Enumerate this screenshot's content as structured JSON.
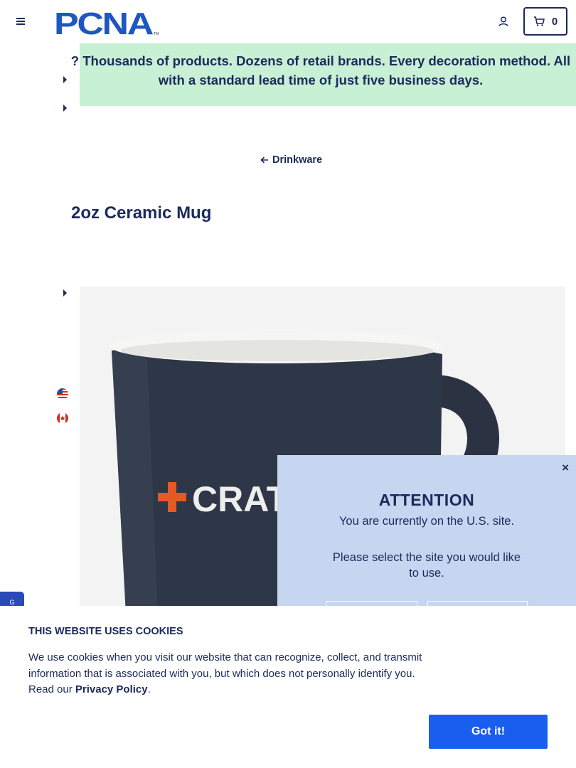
{
  "header": {
    "logo_text": "PCNA",
    "logo_tm": "TM",
    "cart_count": "0",
    "menu_icon": "hamburger-icon",
    "account_icon": "user-icon",
    "cart_icon": "cart-icon"
  },
  "announcement": {
    "text_line1": "Thousands of products. Dozens of retail brands. Every decoration method. All",
    "text_line2": "with a standard lead time of just five business days.",
    "prefix_fragment": "?",
    "background": "#c8f0d4"
  },
  "breadcrumb": {
    "back_label": "Drinkware"
  },
  "product": {
    "title": "2oz Ceramic Mug",
    "image_logo_text": "CRAT"
  },
  "side_tab": {
    "label": "G"
  },
  "country_modal": {
    "title": "ATTENTION",
    "line1": "You are currently on the U.S. site.",
    "line2": "Please select the site you would like to use.",
    "close_label": "×"
  },
  "cookie_banner": {
    "title": "THIS WEBSITE USES COOKIES",
    "body": "We use cookies when you visit our website that can recognize, collect, and transmit information that is associated with you, but which does not personally identify you. Read our ",
    "link_label": "Privacy Policy",
    "body_end": ".",
    "accept_label": "Got it!"
  },
  "colors": {
    "brand_navy": "#1b2a5c",
    "brand_blue": "#1a5ef0",
    "announce_green": "#c8f0d4",
    "modal_blue": "#c6d5f0"
  }
}
